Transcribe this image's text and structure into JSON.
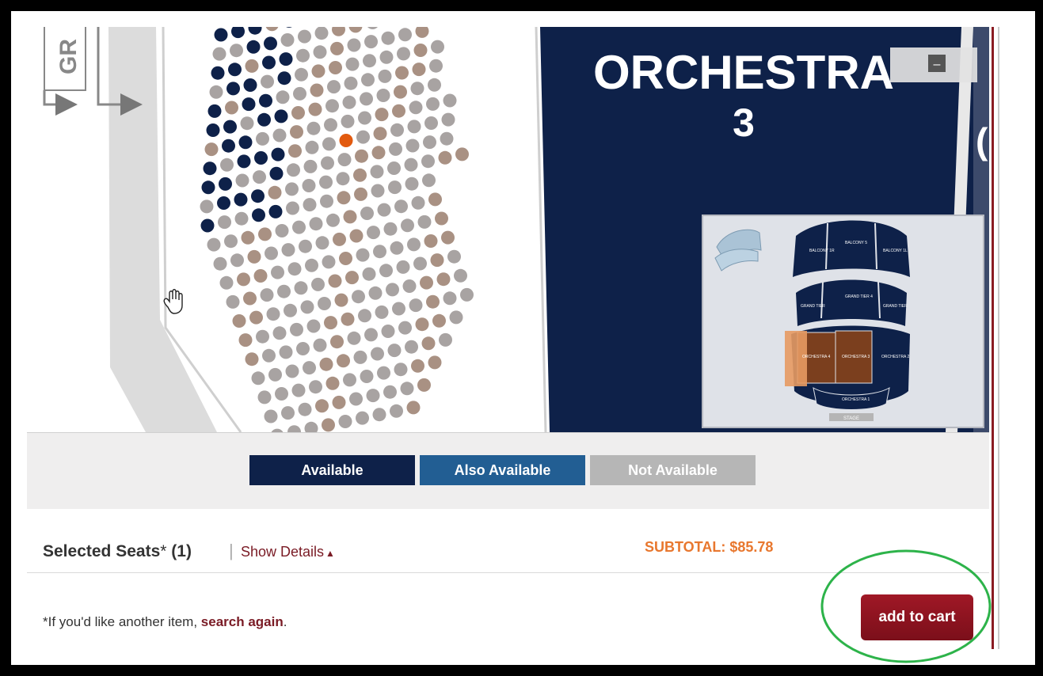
{
  "map": {
    "section_title_line1": "ORCHESTRA",
    "section_title_line2": "3",
    "side_label": "GR",
    "right_partial_label": "(",
    "minimize_glyph": "–",
    "pointer_icon": "hand-cursor-icon"
  },
  "minimap": {
    "sections": {
      "balcony_1r": "BALCONY\n1R",
      "balcony_center": "BALCONY\n5",
      "balcony_1l": "BALCONY\n1L",
      "grand_tier_left": "GRAND TIER",
      "grand_tier_center": "GRAND TIER\n4",
      "grand_tier_right": "GRAND TIER",
      "orch_left": "ORCHESTRA\n4",
      "orch_center": "ORCHESTRA\n3",
      "orch_right": "ORCHESTRA\n2",
      "orch_front": "ORCHESTRA\n1",
      "stage": "STAGE"
    },
    "colors": {
      "section": "#0e2149",
      "selected": "#7b3f1e",
      "viewport": "#e79a62",
      "background": "#dfe2e8"
    }
  },
  "legend": {
    "available": "Available",
    "also_available": "Also Available",
    "not_available": "Not Available",
    "colors": {
      "available": "#0e2149",
      "also_available": "#225e93",
      "not_available": "#b6b6b6"
    }
  },
  "selection": {
    "label": "Selected Seats",
    "asterisk": "*",
    "count": "(1)",
    "separator": "|",
    "show_details": "Show Details",
    "caret": "▲",
    "subtotal": "SUBTOTAL: $85.78"
  },
  "footer": {
    "note_prefix": "*If you'd like another item, ",
    "search_again": "search again",
    "note_suffix": ".",
    "add_to_cart": "add to cart"
  },
  "seat_colors": {
    "navy": "#0e2149",
    "tan": "#a99183",
    "gray": "#a8a3a2",
    "selected": "#e25a0f"
  }
}
